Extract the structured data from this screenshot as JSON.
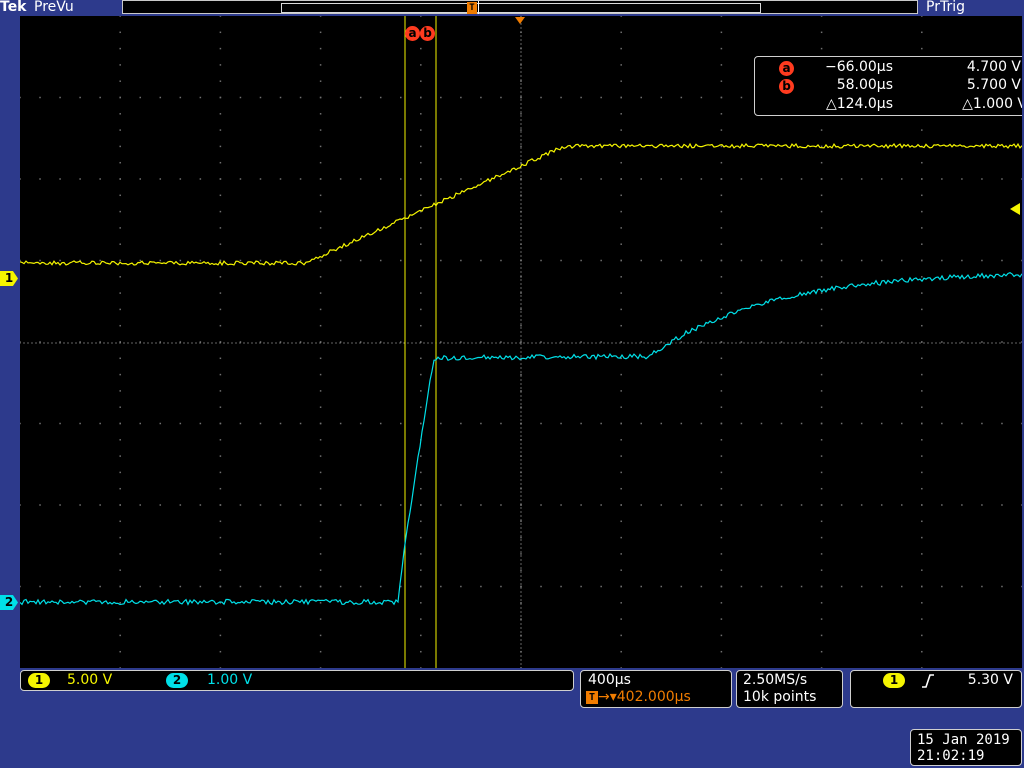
{
  "header": {
    "brand": "Tek",
    "mode": "PreVu",
    "trigger_state": "PrTrig",
    "record_trigger_marker": "T"
  },
  "cursor_labels": {
    "a": "a",
    "b": "b"
  },
  "cursor_readout": {
    "a_badge": "a",
    "b_badge": "b",
    "a_time": "−66.00µs",
    "a_value": "4.700 V",
    "b_time": "58.00µs",
    "b_value": "5.700 V",
    "delta_time": "△124.0µs",
    "delta_value": "△1.000 V"
  },
  "channels": [
    {
      "marker": "1",
      "scale": "5.00 V",
      "color": "#f5f500"
    },
    {
      "marker": "2",
      "scale": "1.00 V",
      "color": "#00e0e8"
    }
  ],
  "timebase": {
    "scale": "400µs",
    "delay_icon": "T",
    "delay": "→▾402.000µs"
  },
  "acquisition": {
    "sample_rate": "2.50MS/s",
    "record_length": "10k points"
  },
  "trigger": {
    "source": "1",
    "slope_icon": "rising-edge-icon",
    "level": "5.30 V"
  },
  "clock": {
    "date": "15 Jan  2019",
    "time": "21:02:19"
  },
  "colors": {
    "background": "#2d3a8c",
    "grid": "#7a7a7a",
    "ch1": "#f5f500",
    "ch2": "#00e0e8",
    "cursor_badge": "#ff3b1f",
    "trigger_marker": "#f07c00"
  }
}
